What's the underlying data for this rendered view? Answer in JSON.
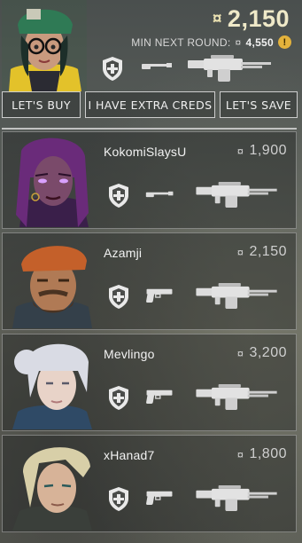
{
  "player": {
    "credits": "2,150",
    "min_next_round_label": "MIN NEXT ROUND:",
    "min_next_round_value": "4,550",
    "warning_glyph": "!",
    "currency_glyph": "¤"
  },
  "buttons": {
    "lets_buy": "LET'S BUY",
    "extra_creds": "I HAVE EXTRA CREDS",
    "lets_save": "LET'S SAVE"
  },
  "teammates": [
    {
      "name": "KokomiSlaysU",
      "credits": "1,900",
      "sidearm": "shorty-icon",
      "hair": "#6a2b7a",
      "skin": "#7a4a6a"
    },
    {
      "name": "Azamji",
      "credits": "2,150",
      "sidearm": "pistol-icon",
      "hair": "#c4602a",
      "skin": "#b07a55"
    },
    {
      "name": "Mevlingo",
      "credits": "3,200",
      "sidearm": "pistol-icon",
      "hair": "#d9dbe4",
      "skin": "#e8d3c8"
    },
    {
      "name": "xHanad7",
      "credits": "1,800",
      "sidearm": "pistol-icon",
      "hair": "#d8cfa8",
      "skin": "#d7b398"
    }
  ],
  "icons": {
    "armor": "heavy-shield-icon",
    "primary": "odin-machine-gun-icon"
  },
  "colors": {
    "credit_gold": "#efe9c8",
    "warning": "#e3b23c"
  }
}
